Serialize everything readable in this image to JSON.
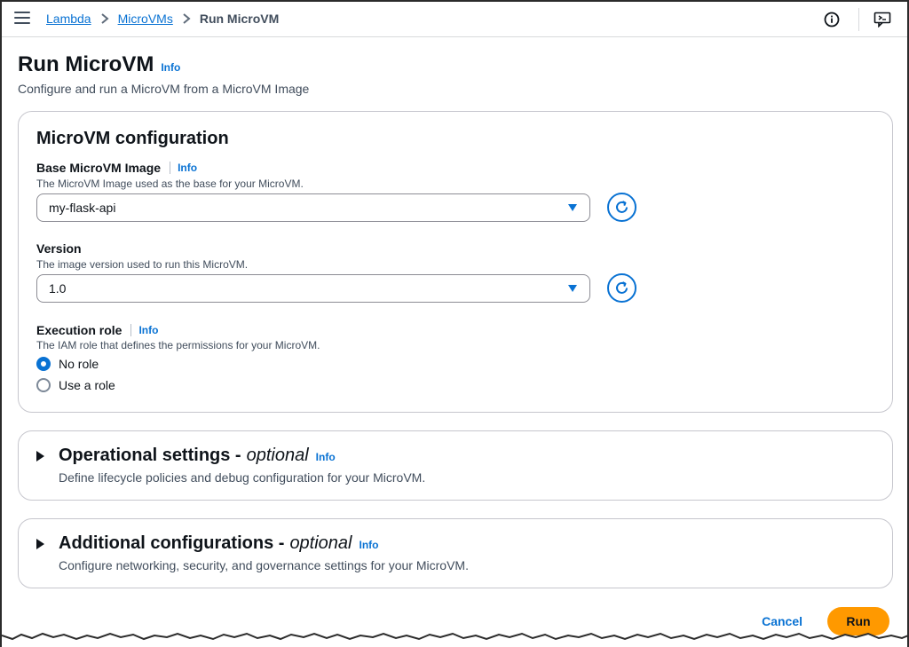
{
  "breadcrumb": {
    "items": [
      "Lambda",
      "MicroVMs"
    ],
    "current": "Run MicroVM"
  },
  "page": {
    "title": "Run MicroVM",
    "info": "Info",
    "description": "Configure and run a MicroVM from a MicroVM Image"
  },
  "config": {
    "heading": "MicroVM configuration",
    "base_image": {
      "label": "Base MicroVM Image",
      "info": "Info",
      "description": "The MicroVM Image used as the base for your MicroVM.",
      "value": "my-flask-api"
    },
    "version": {
      "label": "Version",
      "description": "The image version used to run this MicroVM.",
      "value": "1.0"
    },
    "execution_role": {
      "label": "Execution role",
      "info": "Info",
      "description": "The IAM role that defines the permissions for your MicroVM.",
      "options": [
        "No role",
        "Use a role"
      ],
      "selected": "No role"
    }
  },
  "operational": {
    "title": "Operational settings -",
    "optional": "optional",
    "info": "Info",
    "description": "Define lifecycle policies and debug configuration for your MicroVM."
  },
  "additional": {
    "title": "Additional configurations -",
    "optional": "optional",
    "info": "Info",
    "description": "Configure networking, security, and governance settings for your MicroVM."
  },
  "actions": {
    "cancel": "Cancel",
    "run": "Run"
  },
  "colors": {
    "accent": "#0972d3",
    "primary_button": "#ff9900",
    "text": "#0f141a"
  },
  "icons": [
    "menu-icon",
    "chevron-right-icon",
    "info-circle-icon",
    "feedback-icon",
    "refresh-icon",
    "caret-down-icon",
    "expand-triangle-icon"
  ]
}
